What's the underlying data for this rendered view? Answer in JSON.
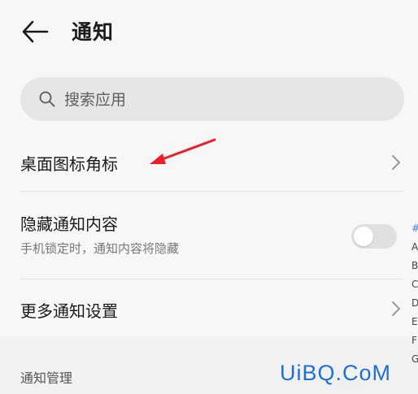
{
  "header": {
    "title": "通知"
  },
  "search": {
    "placeholder": "搜索应用"
  },
  "settings": {
    "badge_label": "桌面图标角标",
    "hide_label": "隐藏通知内容",
    "hide_sub": "手机锁定时，通知内容将隐藏",
    "hide_enabled": false,
    "more_label": "更多通知设置"
  },
  "section": {
    "title": "通知管理"
  },
  "watermark": {
    "text": "UiBQ.CoM"
  },
  "index": [
    "#",
    "A",
    "B",
    "C",
    "D",
    "E",
    "F",
    "G"
  ],
  "colors": {
    "arrow": "#e8202a",
    "watermark": "#1e6fd6",
    "index_hash": "#4a7fe0"
  }
}
